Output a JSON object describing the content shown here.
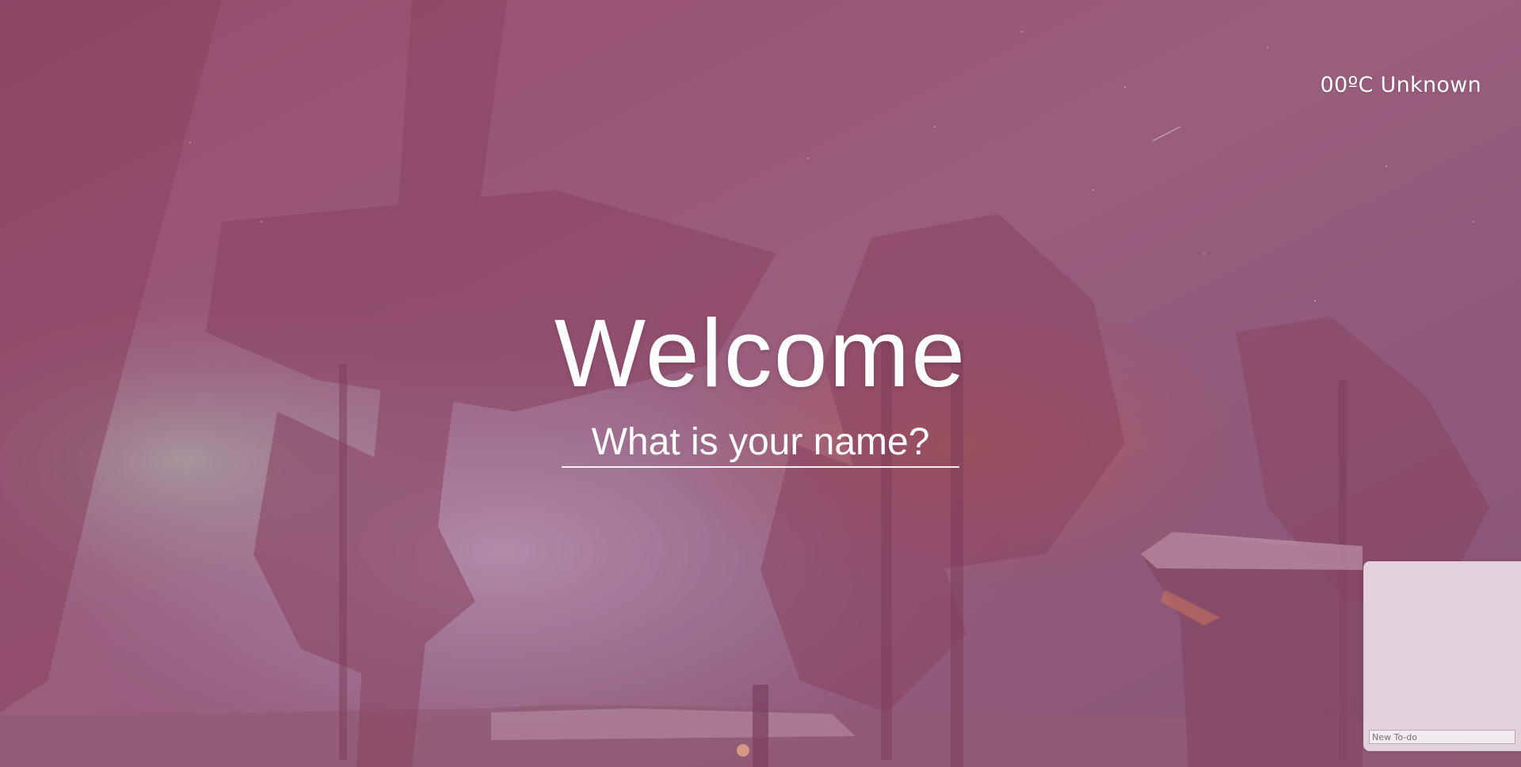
{
  "weather": {
    "text": "00ºC Unknown"
  },
  "greeting": {
    "title": "Welcome",
    "name_placeholder": "What is your name?"
  },
  "todo": {
    "new_placeholder": "New To-do"
  },
  "colors": {
    "overlay_tint": "#b0547a",
    "text": "#ffffff",
    "todo_panel_bg": "#eee2eb"
  }
}
